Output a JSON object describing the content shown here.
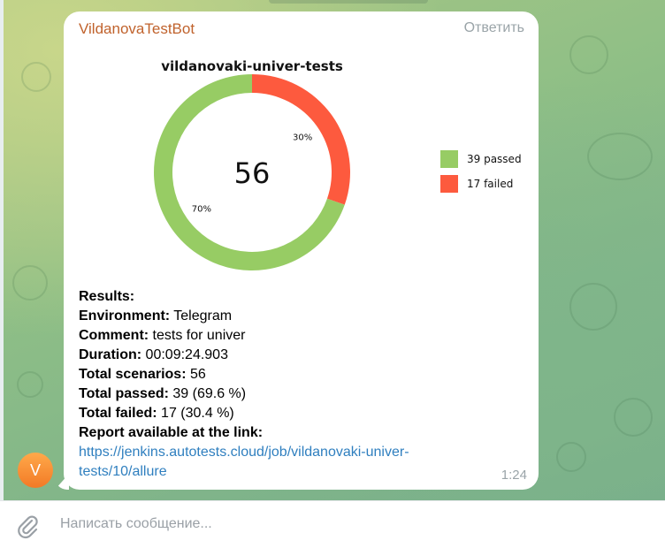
{
  "message": {
    "sender": "VildanovaTestBot",
    "reply_label": "Ответить",
    "time": "1:24",
    "avatar_letter": "V"
  },
  "chart_data": {
    "type": "pie",
    "title": "vildanovaki-univer-tests",
    "center_label": "56",
    "slices": [
      {
        "label": "39 passed",
        "value": 39,
        "percent_label": "70%",
        "color": "#97cc64"
      },
      {
        "label": "17 failed",
        "value": 17,
        "percent_label": "30%",
        "color": "#fd5a3e"
      }
    ],
    "legend_position": "right"
  },
  "results": {
    "header": "Results:",
    "environment_label": "Environment:",
    "environment_value": " Telegram",
    "comment_label": "Comment:",
    "comment_value": " tests for univer",
    "duration_label": "Duration:",
    "duration_value": " 00:09:24.903",
    "scenarios_label": "Total scenarios:",
    "scenarios_value": " 56",
    "passed_label": "Total passed:",
    "passed_value": " 39 (69.6 %)",
    "failed_label": "Total failed:",
    "failed_value": " 17 (30.4 %)",
    "report_label": "Report available at the link:",
    "link_line1": "https://jenkins.autotests.cloud/job/vildanovaki-univer-",
    "link_line2": "tests/10/allure"
  },
  "composer": {
    "placeholder": "Написать сообщение..."
  },
  "icons": {
    "attach": "paperclip-icon"
  }
}
